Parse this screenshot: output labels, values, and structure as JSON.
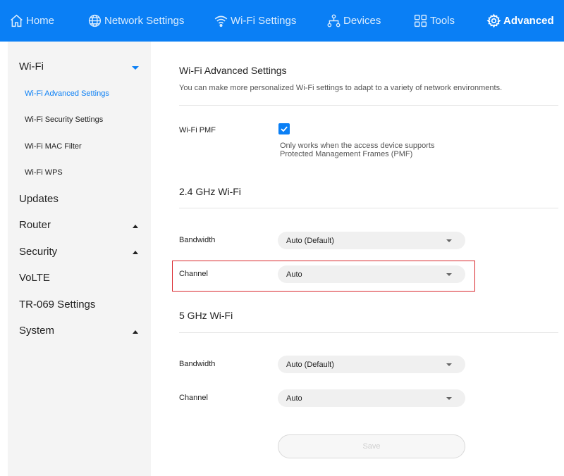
{
  "nav": {
    "home": "Home",
    "network_settings": "Network Settings",
    "wifi_settings": "Wi-Fi Settings",
    "devices": "Devices",
    "tools": "Tools",
    "advanced": "Advanced",
    "active": "advanced",
    "color": "#0a7ff5"
  },
  "sidebar": {
    "wifi": "Wi-Fi",
    "wifi_items": [
      "Wi-Fi Advanced Settings",
      "Wi-Fi Security Settings",
      "Wi-Fi MAC Filter",
      "Wi-Fi WPS"
    ],
    "updates": "Updates",
    "router": "Router",
    "security": "Security",
    "volte": "VoLTE",
    "tr069": "TR-069 Settings",
    "system": "System"
  },
  "main": {
    "title": "Wi-Fi Advanced Settings",
    "description": "You can make more personalized Wi-Fi settings to adapt to a variety of network environments.",
    "pmf_label": "Wi-Fi PMF",
    "pmf_checked": true,
    "pmf_hint_line1": "Only works when the access device supports",
    "pmf_hint_line2": "Protected Management Frames (PMF)",
    "band24": {
      "heading": "2.4 GHz Wi-Fi",
      "bandwidth_label": "Bandwidth",
      "bandwidth_value": "Auto (Default)",
      "channel_label": "Channel",
      "channel_value": "Auto"
    },
    "band5": {
      "heading": "5 GHz Wi-Fi",
      "bandwidth_label": "Bandwidth",
      "bandwidth_value": "Auto (Default)",
      "channel_label": "Channel",
      "channel_value": "Auto"
    },
    "save_label": "Save",
    "highlight_color": "#d9262c"
  }
}
